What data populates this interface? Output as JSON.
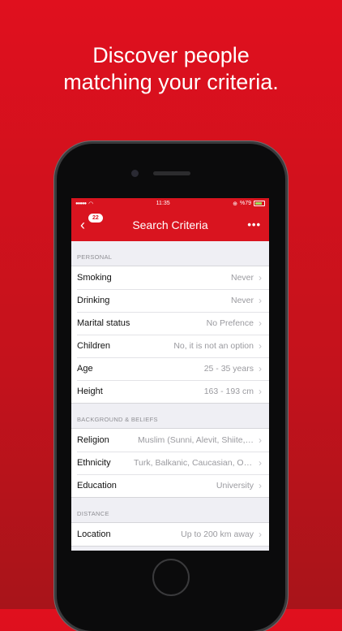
{
  "promo": {
    "line1": "Discover people",
    "line2": "matching your criteria."
  },
  "status": {
    "time": "11:35",
    "battery": "%79"
  },
  "nav": {
    "title": "Search Criteria",
    "badge": "22",
    "back": "‹",
    "more": "•••"
  },
  "sections": {
    "personal": {
      "header": "PERSONAL",
      "rows": [
        {
          "label": "Smoking",
          "value": "Never"
        },
        {
          "label": "Drinking",
          "value": "Never"
        },
        {
          "label": "Marital status",
          "value": "No Prefence"
        },
        {
          "label": "Children",
          "value": "No, it is not an option"
        },
        {
          "label": "Age",
          "value": "25 - 35 years"
        },
        {
          "label": "Height",
          "value": "163 - 193 cm"
        }
      ]
    },
    "background": {
      "header": "BACKGROUND & BELIEFS",
      "rows": [
        {
          "label": "Religion",
          "value": "Muslim (Sunni, Alevit, Shiite,…"
        },
        {
          "label": "Ethnicity",
          "value": "Turk, Balkanic, Caucasian, Ot…"
        },
        {
          "label": "Education",
          "value": "University"
        }
      ]
    },
    "distance": {
      "header": "DISTANCE",
      "rows": [
        {
          "label": "Location",
          "value": "Up to 200 km away"
        }
      ]
    }
  },
  "colors": {
    "brand": "#d9141f",
    "background": "#c4121c"
  }
}
